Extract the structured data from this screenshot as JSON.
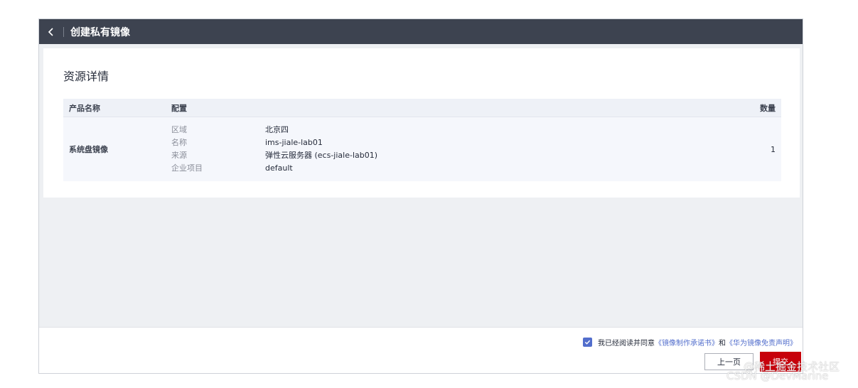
{
  "header": {
    "title": "创建私有镜像"
  },
  "card": {
    "title": "资源详情"
  },
  "table": {
    "columns": [
      "产品名称",
      "配置",
      "数量"
    ],
    "row": {
      "product": "系统盘镜像",
      "config": [
        {
          "key": "区域",
          "value": "北京四"
        },
        {
          "key": "名称",
          "value": "ims-jiale-lab01"
        },
        {
          "key": "来源",
          "value": "弹性云服务器 (ecs-jiale-lab01)"
        },
        {
          "key": "企业项目",
          "value": "default"
        }
      ],
      "quantity": "1"
    }
  },
  "footer": {
    "agree_checked": true,
    "agree_prefix": "我已经阅读并同意",
    "agree_link1": "《镜像制作承诺书》",
    "agree_and": "和",
    "agree_link2": "《华为镜像免责声明》",
    "prev_label": "上一页",
    "submit_label": "提交"
  },
  "watermark": {
    "line1": "@稀土掘金技术社区",
    "line2": "CSDN @DevMarine"
  },
  "colors": {
    "header_bg": "#3d4350",
    "accent": "#526ecc",
    "submit": "#c7000b"
  }
}
